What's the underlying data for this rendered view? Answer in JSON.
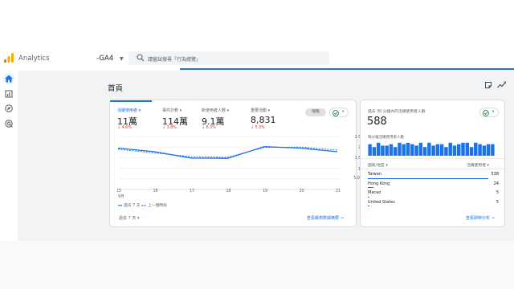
{
  "app": {
    "name": "Analytics",
    "property": "-GA4",
    "brand_color": "#f9ab00"
  },
  "search": {
    "placeholder": "請嘗試搜尋「行為總覽」"
  },
  "page": {
    "title": "首頁"
  },
  "metrics": [
    {
      "label": "活躍使用者",
      "value": "11萬",
      "delta": "4.6%"
    },
    {
      "label": "事件計數",
      "value": "114萬",
      "delta": "3.8%"
    },
    {
      "label": "新使用者人數",
      "value": "9.1萬",
      "delta": "6.3%"
    },
    {
      "label": "重要活動",
      "value": "8,831",
      "delta": "5.3%"
    }
  ],
  "compare": {
    "label": "暱暱"
  },
  "chart_data": {
    "type": "line",
    "x": [
      "15",
      "16",
      "17",
      "18",
      "19",
      "20",
      "21"
    ],
    "x_sublabel": "9月",
    "y_ticks": [
      "2.5萬",
      "2萬",
      "1.5萬",
      "1萬",
      "5,000",
      "0"
    ],
    "ylim": [
      0,
      25000
    ],
    "series": [
      {
        "name": "過去 7 天",
        "values": [
          19500,
          17800,
          14800,
          14700,
          20200,
          19500,
          17800
        ],
        "color": "#1a73e8",
        "style": "solid"
      },
      {
        "name": "上一個時段",
        "values": [
          19000,
          17200,
          15500,
          15200,
          19800,
          20000,
          18600
        ],
        "color": "#1a73e8",
        "style": "dashed"
      }
    ],
    "grid": true
  },
  "legend": {
    "current": "過去 7 天",
    "previous": "上一個時段"
  },
  "footer": {
    "date_range": "過去 7 天",
    "report_link": "查看報表數據摘要"
  },
  "realtime": {
    "title": "過去 30 分鐘內的活躍使用者人數",
    "value": "588",
    "subtitle": "每分鐘活躍使用者人數",
    "bars": [
      8,
      6,
      9,
      7,
      7,
      8,
      6,
      9,
      8,
      9,
      8,
      7,
      9,
      6,
      9,
      7,
      8,
      8,
      6,
      9,
      7,
      8,
      9,
      9,
      6,
      9,
      8,
      7,
      8,
      8
    ],
    "column_country": "國家/地區",
    "column_users": "活躍使用者",
    "rows": [
      {
        "name": "Taiwan",
        "value": "538"
      },
      {
        "name": "Hong Kong",
        "value": "24"
      },
      {
        "name": "Macao",
        "value": "5"
      },
      {
        "name": "United States",
        "value": "5"
      }
    ],
    "link": "查看即時分析"
  }
}
